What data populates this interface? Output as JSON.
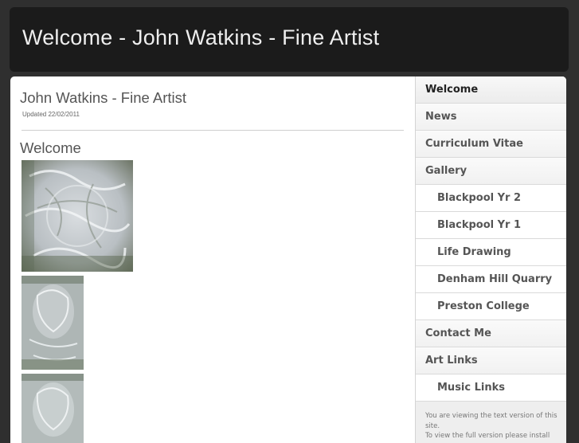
{
  "header": {
    "title": "Welcome - John Watkins - Fine Artist"
  },
  "main": {
    "site_title": "John Watkins - Fine Artist",
    "updated": "Updated 22/02/2011",
    "page_heading": "Welcome"
  },
  "nav": {
    "items": [
      {
        "label": "Welcome"
      },
      {
        "label": "News"
      },
      {
        "label": "Curriculum Vitae"
      },
      {
        "label": "Gallery"
      },
      {
        "label": "Blackpool Yr 2"
      },
      {
        "label": "Blackpool Yr 1"
      },
      {
        "label": "Life Drawing"
      },
      {
        "label": "Denham Hill Quarry"
      },
      {
        "label": "Preston College"
      },
      {
        "label": "Contact Me"
      },
      {
        "label": "Art Links"
      },
      {
        "label": "Music Links"
      }
    ]
  },
  "notice": {
    "line1": "You are viewing the text version of this site.",
    "line2": "To view the full version please install"
  },
  "colors": {
    "background": "#2f2f2f",
    "header": "#1b1b1b",
    "panel": "#ffffff",
    "text": "#555555"
  }
}
